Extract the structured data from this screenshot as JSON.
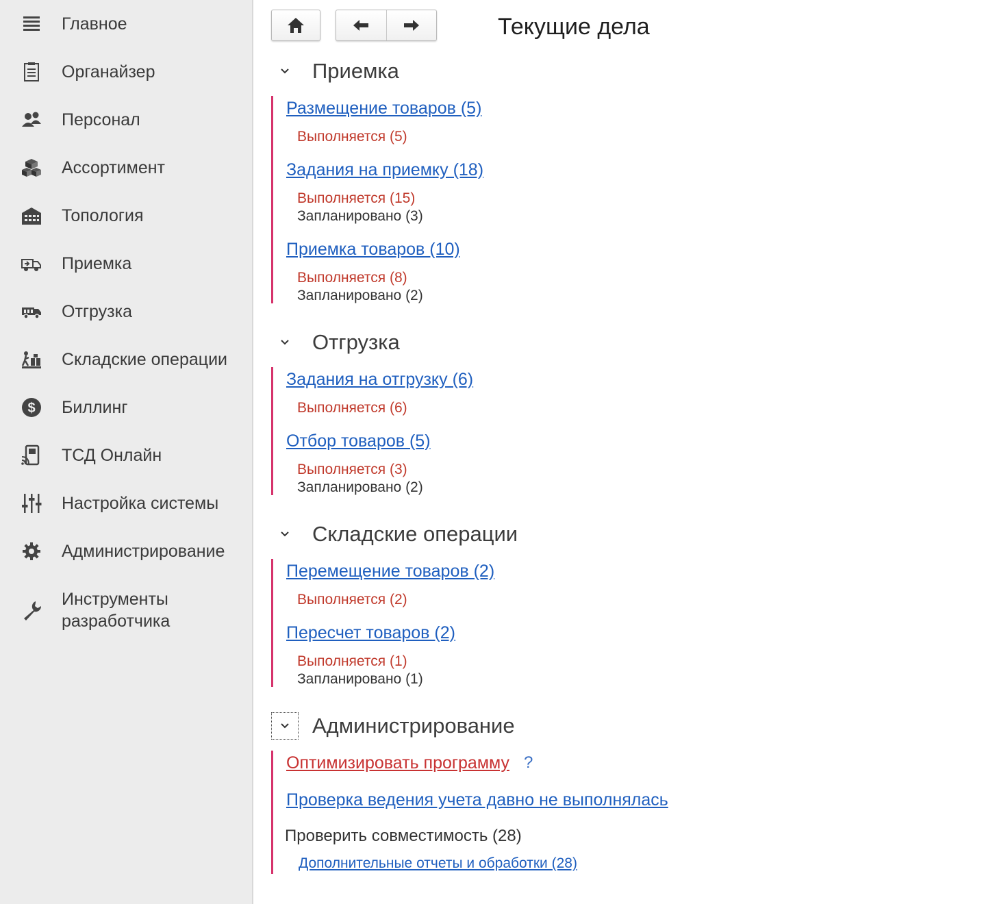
{
  "sidebar": {
    "items": [
      {
        "label": "Главное",
        "icon": "menu-icon"
      },
      {
        "label": "Органайзер",
        "icon": "organizer-icon"
      },
      {
        "label": "Персонал",
        "icon": "people-icon"
      },
      {
        "label": "Ассортимент",
        "icon": "boxes-icon"
      },
      {
        "label": "Топология",
        "icon": "warehouse-icon"
      },
      {
        "label": "Приемка",
        "icon": "receiving-truck-icon"
      },
      {
        "label": "Отгрузка",
        "icon": "shipping-truck-icon"
      },
      {
        "label": "Складские операции",
        "icon": "warehouse-ops-icon"
      },
      {
        "label": "Биллинг",
        "icon": "dollar-icon"
      },
      {
        "label": "ТСД Онлайн",
        "icon": "terminal-icon"
      },
      {
        "label": "Настройка системы",
        "icon": "sliders-icon"
      },
      {
        "label": "Администрирование",
        "icon": "gear-icon"
      },
      {
        "label": "Инструменты\nразработчика",
        "icon": "wrench-icon"
      }
    ]
  },
  "toolbar": {
    "home_icon": "home-icon",
    "back_icon": "arrow-left-icon",
    "forward_icon": "arrow-right-icon"
  },
  "page": {
    "title": "Текущие дела"
  },
  "sections": {
    "receiving": {
      "title": "Приемка",
      "tasks": [
        {
          "link": "Размещение товаров (5)",
          "running": "Выполняется (5)"
        },
        {
          "link": "Задания на приемку (18)",
          "running": "Выполняется (15)",
          "planned": "Запланировано (3)"
        },
        {
          "link": "Приемка товаров (10)",
          "running": "Выполняется (8)",
          "planned": "Запланировано (2)"
        }
      ]
    },
    "shipping": {
      "title": "Отгрузка",
      "tasks": [
        {
          "link": "Задания на отгрузку (6)",
          "running": "Выполняется (6)"
        },
        {
          "link": "Отбор товаров (5)",
          "running": "Выполняется (3)",
          "planned": "Запланировано (2)"
        }
      ]
    },
    "warehouse": {
      "title": "Складские операции",
      "tasks": [
        {
          "link": "Перемещение товаров (2)",
          "running": "Выполняется (2)"
        },
        {
          "link": "Пересчет товаров (2)",
          "running": "Выполняется (1)",
          "planned": "Запланировано (1)"
        }
      ]
    },
    "admin": {
      "title": "Администрирование",
      "optimize": "Оптимизировать программу",
      "help": "?",
      "check": "Проверка ведения учета давно не выполнялась",
      "compat": "Проверить совместимость (28)",
      "extra": "Дополнительные отчеты и обработки (28)"
    }
  },
  "colors": {
    "accent_bar": "#d6336c",
    "link": "#1f5fbf",
    "running": "#c0392b",
    "sidebar_bg": "#ececec"
  }
}
